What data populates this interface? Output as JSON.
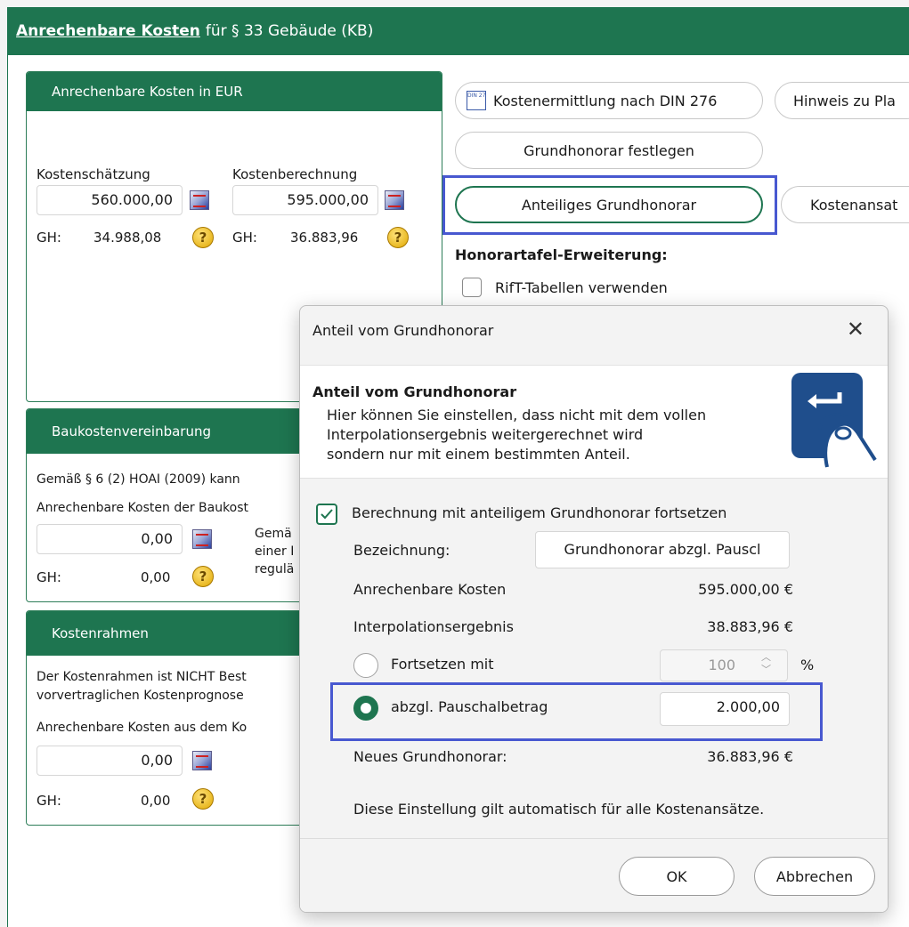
{
  "app": {
    "title_link": "Anrechenbare Kosten",
    "title_rest": "für § 33 Gebäude (KB)"
  },
  "panel_costs": {
    "heading": "Anrechenbare Kosten in EUR",
    "estimate_label": "Kostenschätzung",
    "estimate_value": "560.000,00",
    "calculation_label": "Kostenberechnung",
    "calculation_value": "595.000,00",
    "gh_label_1": "GH:",
    "gh_value_1": "34.988,08",
    "gh_label_2": "GH:",
    "gh_value_2": "36.883,96"
  },
  "panel_agreement": {
    "heading": "Baukostenvereinbarung",
    "line1": "Gemäß § 6 (2) HOAI (2009) kann",
    "line2": "Anrechenbare Kosten der Baukost",
    "value": "0,00",
    "note1": "Gemä",
    "note2": "einer I",
    "note3": "regulä",
    "gh_label": "GH:",
    "gh_value": "0,00"
  },
  "panel_frame": {
    "heading": "Kostenrahmen",
    "line1": "Der Kostenrahmen ist NICHT Best",
    "line2": "vorvertraglichen Kostenprognose",
    "line3": "Anrechenbare Kosten aus dem Ko",
    "value": "0,00",
    "gh_label": "GH:",
    "gh_value": "0,00"
  },
  "buttons": {
    "din276_icon_text": "DIN 276",
    "din276": "Kostenermittlung nach DIN 276",
    "hint": "Hinweis zu Pla",
    "set_base_fee": "Grundhonorar festlegen",
    "partial_fee": "Anteiliges Grundhonorar",
    "cost_items": "Kostenansat"
  },
  "honorartafel": {
    "heading": "Honorartafel-Erweiterung:",
    "rift_label": "RifT-Tabellen verwenden"
  },
  "dialog": {
    "title": "Anteil vom Grundhonorar",
    "close": "✕",
    "header_title": "Anteil vom Grundhonorar",
    "header_line1": "Hier können Sie einstellen, dass nicht mit dem vollen",
    "header_line2": "Interpolationsergebnis weitergerechnet wird",
    "header_line3": "sondern nur mit einem bestimmten Anteil.",
    "continue_checkbox": "Berechnung mit anteiligem Grundhonorar fortsetzen",
    "designation_label": "Bezeichnung:",
    "designation_value": "Grundhonorar abzgl. Pauscl",
    "eligible_costs_label": "Anrechenbare Kosten",
    "eligible_costs_value": "595.000,00 €",
    "interpolation_label": "Interpolationsergebnis",
    "interpolation_value": "38.883,96 €",
    "continue_with_label": "Fortsetzen mit",
    "percent_value": "100",
    "percent_unit": "%",
    "lump_sum_label": "abzgl. Pauschalbetrag",
    "lump_sum_value": "2.000,00",
    "new_fee_label": "Neues Grundhonorar:",
    "new_fee_value": "36.883,96 €",
    "note": "Diese Einstellung gilt automatisch für alle Kostenansätze.",
    "ok": "OK",
    "cancel": "Abbrechen"
  },
  "colors": {
    "accent": "#1e7550",
    "highlight": "#4858d0"
  }
}
